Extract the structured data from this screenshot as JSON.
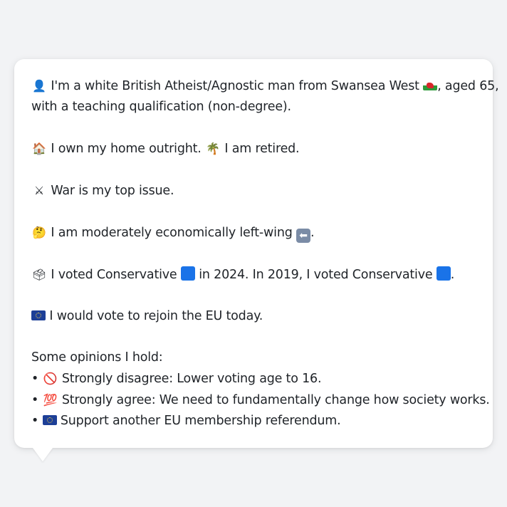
{
  "profile": {
    "line1": "I'm a white British Atheist/Agnostic man from Swansea West",
    "line1_tail": ", aged 65,",
    "line2": "with a teaching qualification (non-degree).",
    "home": "I own my home outright.",
    "retired": "I am retired.",
    "issue": "War is my top issue.",
    "econ": "I am moderately economically left-wing",
    "econ_tail": ".",
    "vote_a": "I voted Conservative",
    "vote_b": "in 2024. In 2019, I voted Conservative",
    "vote_tail": ".",
    "eu": "I would vote to rejoin the EU today."
  },
  "opinions": {
    "heading": "Some opinions I hold:",
    "items": [
      {
        "bullet": "•",
        "text": "Strongly disagree: Lower voting age to 16."
      },
      {
        "bullet": "•",
        "text": "Strongly agree: We need to fundamentally change how society works."
      },
      {
        "bullet": "•",
        "text": "Support another EU membership referendum."
      }
    ]
  },
  "icons": {
    "person": "👤",
    "house": "🏠",
    "palm": "🌴",
    "swords": "⚔",
    "thinking": "🤔",
    "ballot": "🗳",
    "no_entry": "🚫",
    "hundred": "💯",
    "arrow_left": "⬅"
  },
  "colors": {
    "conservative_blue": "#1a73e8",
    "card_bg": "#ffffff",
    "page_bg": "#f2f3f5"
  }
}
